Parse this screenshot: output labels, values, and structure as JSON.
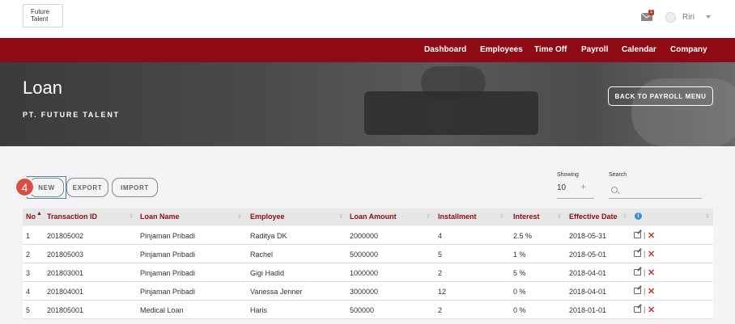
{
  "header": {
    "logo_line1": "Future",
    "logo_line2": "Talent",
    "mail_badge": "1",
    "user_name": "Riri"
  },
  "nav": [
    "Dashboard",
    "Employees",
    "Time Off",
    "Payroll",
    "Calendar",
    "Company"
  ],
  "hero": {
    "title": "Loan",
    "subtitle": "PT. FUTURE TALENT",
    "back_button": "BACK TO PAYROLL MENU"
  },
  "toolbar": {
    "step": "4",
    "new_label": "NEW",
    "export_label": "EXPORT",
    "import_label": "IMPORT",
    "showing_label": "Showing",
    "showing_value": "10",
    "search_label": "Search",
    "search_placeholder": ""
  },
  "table": {
    "columns": [
      "No",
      "Transaction ID",
      "Loan Name",
      "Employee",
      "Loan Amount",
      "Installment",
      "Interest",
      "Effective Date"
    ],
    "rows": [
      [
        "1",
        "201805002",
        "Pinjaman Pribadi",
        "Raditya DK",
        "2000000",
        "4",
        "2.5 %",
        "2018-05-31"
      ],
      [
        "2",
        "201805003",
        "Pinjaman Pribadi",
        "Rachel",
        "5000000",
        "5",
        "1 %",
        "2018-05-01"
      ],
      [
        "3",
        "201803001",
        "Pinjaman Pribadi",
        "Gigi Hadid",
        "1000000",
        "2",
        "5 %",
        "2018-04-01"
      ],
      [
        "4",
        "201804001",
        "Pinjaman Pribadi",
        "Vanessa Jenner",
        "3000000",
        "12",
        "0 %",
        "2018-04-01"
      ],
      [
        "5",
        "201805001",
        "Medical Loan",
        "Haris",
        "500000",
        "2",
        "0 %",
        "2018-01-01"
      ]
    ]
  },
  "colors": {
    "brand": "#8f0b13",
    "delete": "#c0392b",
    "info": "#3a8fd6",
    "highlight": "#4d7fb8"
  }
}
